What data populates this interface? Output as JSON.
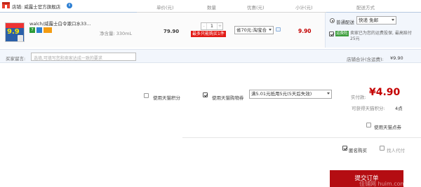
{
  "shop": {
    "label": "店铺: 威露士官方旗舰店",
    "badge": "i"
  },
  "columns": {
    "unit_price": "单价(元)",
    "quantity": "数量",
    "discount": "优惠(元)",
    "subtotal": "小计(元)",
    "shipping": "配送方式"
  },
  "product": {
    "thumb_number": "9.9",
    "title": "walch/威露士白令漱口水33...",
    "spec": "净含量: 330mL",
    "price": "79.90",
    "quantity": "1",
    "qty_minus": "-",
    "qty_plus": "+",
    "limit_tag": "最多只能购买1件",
    "discount_select": "省70元:淘宝合",
    "subtotal": "9.90",
    "shipping_option_label": "普通配送",
    "shipping_select": "快递 免邮",
    "insurance_badge": "运费险",
    "insurance_text": "卖家已为您的运费投保, 最高赔付25元"
  },
  "message": {
    "label": "买家留言:",
    "placeholder": "选填,可填写您和卖家达成一致的要求",
    "shop_total_label": "店铺合计(含运费):",
    "shop_total": "¥9.90"
  },
  "options": {
    "tmall_points_label": "使用天猫积分",
    "tmall_coupon_label": "使用天猫购物券",
    "coupon_select": "满5.01元抵用5元(5天后失效)",
    "paid_label": "实付款:",
    "paid_value": "¥4.90",
    "points_label": "可获得天猫积分:",
    "points_value": "4点",
    "tmall_stamp_label": "使用天猫点券",
    "anonymous_label": "匿名购买",
    "proxy_pay_label": "找人代付",
    "submit_label": "提交订单"
  },
  "watermark": "佳铺网 huim.com",
  "colors": {
    "price_red": "#c40000",
    "submit_bg": "#b40d12",
    "limit_red": "#e21b16"
  }
}
